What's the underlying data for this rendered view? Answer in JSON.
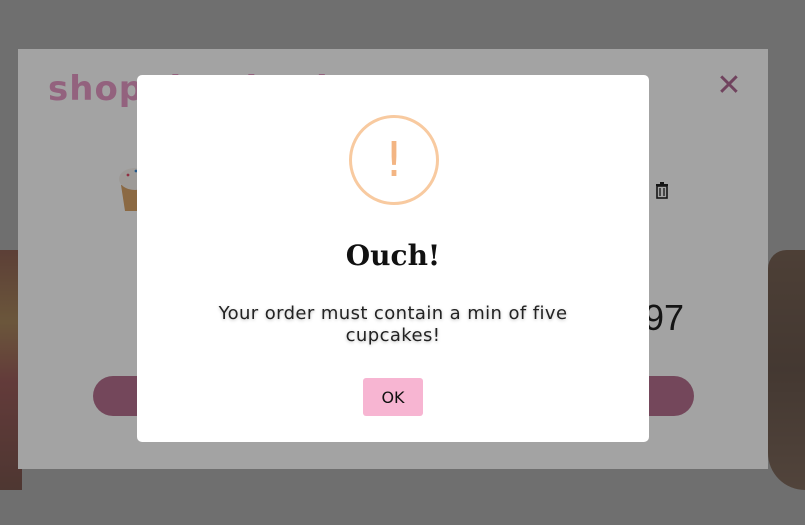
{
  "cart": {
    "title": "shopping basket",
    "total_fragment": "97"
  },
  "alert": {
    "icon_symbol": "!",
    "title": "Ouch!",
    "message": "Your order must contain a min of five cupcakes!",
    "ok_label": "OK",
    "icon_color": "#f8caa0",
    "button_color": "#f7b5d2"
  }
}
